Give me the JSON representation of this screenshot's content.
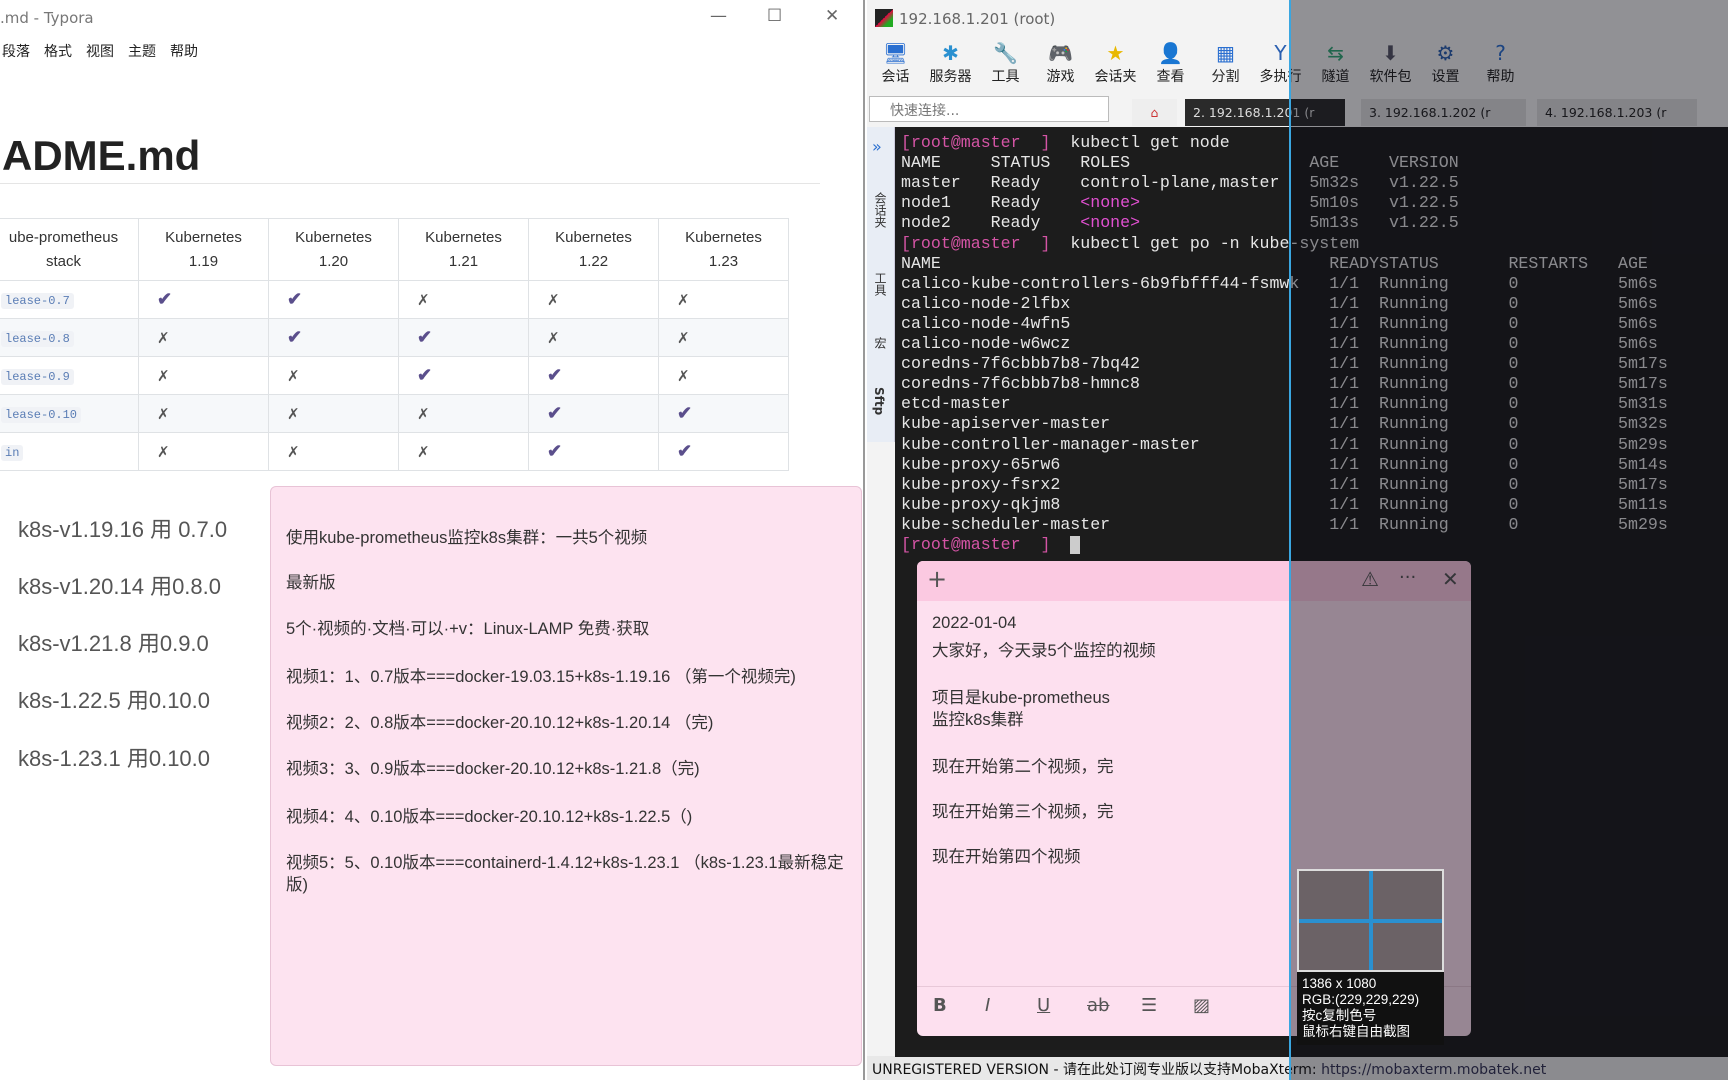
{
  "typora": {
    "title": ".md - Typora",
    "menu": [
      "段落",
      "格式",
      "视图",
      "主题",
      "帮助"
    ],
    "heading": "ADME.md",
    "table": {
      "headers": [
        [
          "ube-prometheus",
          "stack"
        ],
        [
          "Kubernetes",
          "1.19"
        ],
        [
          "Kubernetes",
          "1.20"
        ],
        [
          "Kubernetes",
          "1.21"
        ],
        [
          "Kubernetes",
          "1.22"
        ],
        [
          "Kubernetes",
          "1.23"
        ]
      ],
      "rows": [
        [
          "lease-0.7",
          "✔",
          "✔",
          "✗",
          "✗",
          "✗"
        ],
        [
          "lease-0.8",
          "✗",
          "✔",
          "✔",
          "✗",
          "✗"
        ],
        [
          "lease-0.9",
          "✗",
          "✗",
          "✔",
          "✔",
          "✗"
        ],
        [
          "lease-0.10",
          "✗",
          "✗",
          "✗",
          "✔",
          "✔"
        ],
        [
          "in",
          "✗",
          "✗",
          "✗",
          "✔",
          "✔"
        ]
      ]
    },
    "versions": [
      "k8s-v1.19.16 用 0.7.0",
      "k8s-v1.20.14  用0.8.0",
      "k8s-v1.21.8  用0.9.0",
      "k8s-1.22.5 用0.10.0",
      "k8s-1.23.1 用0.10.0"
    ],
    "notes": [
      "使用kube-prometheus监控k8s集群：一共5个视频",
      "最新版",
      "5个·视频的·文档·可以·+v：Linux-LAMP 免费·获取",
      "视频1：1、0.7版本===docker-19.03.15+k8s-1.19.16 （第一个视频完)",
      "视频2：2、0.8版本===docker-20.10.12+k8s-1.20.14 （完)",
      "视频3：3、0.9版本===docker-20.10.12+k8s-1.21.8（完)",
      "视频4：4、0.10版本===docker-20.10.12+k8s-1.22.5（)",
      "视频5：5、0.10版本===containerd-1.4.12+k8s-1.23.1 （k8s-1.23.1最新稳定版)"
    ]
  },
  "moba": {
    "title": "192.168.1.201 (root)",
    "toolbar": [
      {
        "label": "会话",
        "icon": "session-icon",
        "glyph": "🖥"
      },
      {
        "label": "服务器",
        "icon": "servers-icon",
        "glyph": "✱"
      },
      {
        "label": "工具",
        "icon": "tools-icon",
        "glyph": "🔧"
      },
      {
        "label": "游戏",
        "icon": "games-icon",
        "glyph": "🎮"
      },
      {
        "label": "会话夹",
        "icon": "star-icon",
        "glyph": "★"
      },
      {
        "label": "查看",
        "icon": "view-icon",
        "glyph": "👤"
      },
      {
        "label": "分割",
        "icon": "split-icon",
        "glyph": "▦"
      },
      {
        "label": "多执行",
        "icon": "multiexec-icon",
        "glyph": "Y"
      },
      {
        "label": "隧道",
        "icon": "tunnel-icon",
        "glyph": "⇆"
      },
      {
        "label": "软件包",
        "icon": "packages-icon",
        "glyph": "⬇"
      },
      {
        "label": "设置",
        "icon": "settings-icon",
        "glyph": "⚙"
      },
      {
        "label": "帮助",
        "icon": "help-icon",
        "glyph": "?"
      }
    ],
    "quick_connect_placeholder": "快速连接...",
    "tabs": [
      "2. 192.168.1.201 (r",
      "3. 192.168.1.202 (r",
      "4. 192.168.1.203 (r"
    ],
    "sidebar": [
      "会话夹",
      "工具",
      "宏",
      "Sftp"
    ],
    "terminal": {
      "prompt": {
        "user": "root",
        "host": "master"
      },
      "cmd1": "kubectl get node",
      "node_headers": [
        "NAME",
        "STATUS",
        "ROLES",
        "AGE",
        "VERSION"
      ],
      "nodes": [
        [
          "master",
          "Ready",
          "control-plane,master",
          "5m32s",
          "v1.22.5"
        ],
        [
          "node1",
          "Ready",
          "<none>",
          "5m10s",
          "v1.22.5"
        ],
        [
          "node2",
          "Ready",
          "<none>",
          "5m13s",
          "v1.22.5"
        ]
      ],
      "cmd2": "kubectl get po -n kube-system",
      "pod_headers": [
        "NAME",
        "READY",
        "STATUS",
        "RESTARTS",
        "AGE"
      ],
      "pods": [
        [
          "calico-kube-controllers-6b9fbfff44-fsmwk",
          "1/1",
          "Running",
          "0",
          "5m6s"
        ],
        [
          "calico-node-2lfbx",
          "1/1",
          "Running",
          "0",
          "5m6s"
        ],
        [
          "calico-node-4wfn5",
          "1/1",
          "Running",
          "0",
          "5m6s"
        ],
        [
          "calico-node-w6wcz",
          "1/1",
          "Running",
          "0",
          "5m6s"
        ],
        [
          "coredns-7f6cbbb7b8-7bq42",
          "1/1",
          "Running",
          "0",
          "5m17s"
        ],
        [
          "coredns-7f6cbbb7b8-hmnc8",
          "1/1",
          "Running",
          "0",
          "5m17s"
        ],
        [
          "etcd-master",
          "1/1",
          "Running",
          "0",
          "5m31s"
        ],
        [
          "kube-apiserver-master",
          "1/1",
          "Running",
          "0",
          "5m32s"
        ],
        [
          "kube-controller-manager-master",
          "1/1",
          "Running",
          "0",
          "5m29s"
        ],
        [
          "kube-proxy-65rw6",
          "1/1",
          "Running",
          "0",
          "5m14s"
        ],
        [
          "kube-proxy-fsrx2",
          "1/1",
          "Running",
          "0",
          "5m17s"
        ],
        [
          "kube-proxy-qkjm8",
          "1/1",
          "Running",
          "0",
          "5m11s"
        ],
        [
          "kube-scheduler-master",
          "1/1",
          "Running",
          "0",
          "5m29s"
        ]
      ]
    },
    "status": {
      "text": "UNREGISTERED VERSION  - 请在此处订阅专业版以支持MobaXterm: ",
      "link": "https://mobaxterm.mobatek.net"
    }
  },
  "sticky": {
    "lines": [
      "2022-01-04",
      "大家好，今天录5个监控的视频",
      "项目是kube-prometheus",
      "监控k8s集群",
      "现在开始第二个视频，完",
      "现在开始第三个视频，完",
      "现在开始第四个视频"
    ]
  },
  "picker": {
    "size": "1386 x 1080",
    "rgb": "RGB:(229,229,229)",
    "hint1": "按c复制色号",
    "hint2": "鼠标右键自由截图"
  }
}
